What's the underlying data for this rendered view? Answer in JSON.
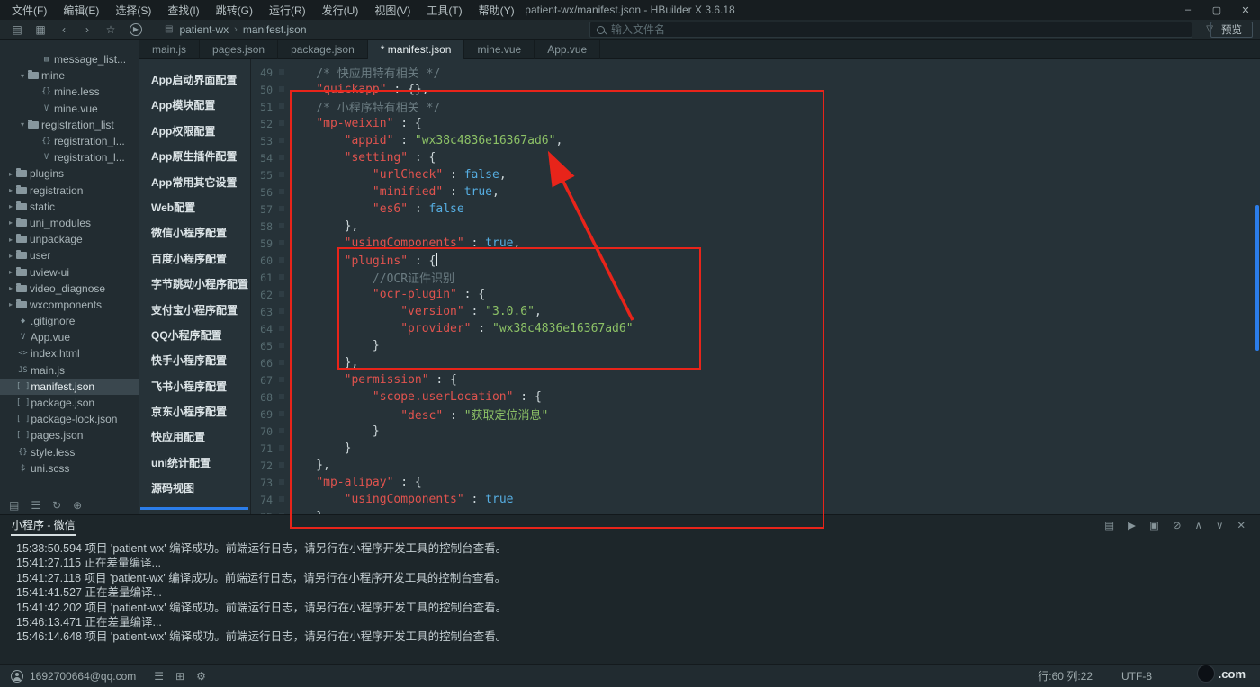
{
  "window": {
    "title": "patient-wx/manifest.json - HBuilder X 3.6.18",
    "menus": [
      "文件(F)",
      "编辑(E)",
      "选择(S)",
      "查找(I)",
      "跳转(G)",
      "运行(R)",
      "发行(U)",
      "视图(V)",
      "工具(T)",
      "帮助(Y)"
    ],
    "controls": [
      {
        "name": "minimize-button",
        "glyph": "–"
      },
      {
        "name": "maximize-button",
        "glyph": "▢"
      },
      {
        "name": "close-button",
        "glyph": "✕"
      }
    ]
  },
  "toolbar": {
    "icons": [
      {
        "name": "new-file-icon",
        "glyph": "▤"
      },
      {
        "name": "save-icon",
        "glyph": "▦"
      },
      {
        "name": "back-icon",
        "glyph": "‹"
      },
      {
        "name": "forward-icon",
        "glyph": "›"
      },
      {
        "name": "favorite-icon",
        "glyph": "☆"
      },
      {
        "name": "run-icon",
        "glyph": "▶"
      }
    ],
    "breadcrumb": [
      "patient-wx",
      "manifest.json"
    ],
    "search_placeholder": "输入文件名",
    "filter_icon": "▽",
    "preview_button": "预览"
  },
  "tabs": [
    {
      "label": "main.js",
      "active": false
    },
    {
      "label": "pages.json",
      "active": false
    },
    {
      "label": "package.json",
      "active": false
    },
    {
      "label": "* manifest.json",
      "active": true
    },
    {
      "label": "mine.vue",
      "active": false
    },
    {
      "label": "App.vue",
      "active": false
    }
  ],
  "sidebar": {
    "items": [
      {
        "label": "message_list...",
        "level": 2,
        "kind": "file",
        "icon": "▤"
      },
      {
        "label": "mine",
        "level": 1,
        "kind": "folder-open"
      },
      {
        "label": "mine.less",
        "level": 2,
        "kind": "file",
        "icon": "{}"
      },
      {
        "label": "mine.vue",
        "level": 2,
        "kind": "file",
        "icon": "V"
      },
      {
        "label": "registration_list",
        "level": 1,
        "kind": "folder-open"
      },
      {
        "label": "registration_l...",
        "level": 2,
        "kind": "file",
        "icon": "{}"
      },
      {
        "label": "registration_l...",
        "level": 2,
        "kind": "file",
        "icon": "V"
      },
      {
        "label": "plugins",
        "level": 0,
        "kind": "folder"
      },
      {
        "label": "registration",
        "level": 0,
        "kind": "folder"
      },
      {
        "label": "static",
        "level": 0,
        "kind": "folder"
      },
      {
        "label": "uni_modules",
        "level": 0,
        "kind": "folder"
      },
      {
        "label": "unpackage",
        "level": 0,
        "kind": "folder"
      },
      {
        "label": "user",
        "level": 0,
        "kind": "folder"
      },
      {
        "label": "uview-ui",
        "level": 0,
        "kind": "folder"
      },
      {
        "label": "video_diagnose",
        "level": 0,
        "kind": "folder"
      },
      {
        "label": "wxcomponents",
        "level": 0,
        "kind": "folder"
      },
      {
        "label": ".gitignore",
        "level": 0,
        "kind": "file",
        "icon": "◆"
      },
      {
        "label": "App.vue",
        "level": 0,
        "kind": "file",
        "icon": "V"
      },
      {
        "label": "index.html",
        "level": 0,
        "kind": "file",
        "icon": "<>"
      },
      {
        "label": "main.js",
        "level": 0,
        "kind": "file",
        "icon": "JS"
      },
      {
        "label": "manifest.json",
        "level": 0,
        "kind": "file",
        "icon": "[ ]",
        "selected": true
      },
      {
        "label": "package.json",
        "level": 0,
        "kind": "file",
        "icon": "[ ]"
      },
      {
        "label": "package-lock.json",
        "level": 0,
        "kind": "file",
        "icon": "[ ]"
      },
      {
        "label": "pages.json",
        "level": 0,
        "kind": "file",
        "icon": "[ ]"
      },
      {
        "label": "style.less",
        "level": 0,
        "kind": "file",
        "icon": "{}"
      },
      {
        "label": "uni.scss",
        "level": 0,
        "kind": "file",
        "icon": "$"
      }
    ],
    "bottom_icons": [
      {
        "name": "explorer-icon",
        "glyph": "▤"
      },
      {
        "name": "outline-icon",
        "glyph": "☰"
      },
      {
        "name": "refresh-icon",
        "glyph": "↻"
      },
      {
        "name": "add-icon",
        "glyph": "⊕"
      }
    ]
  },
  "config_panel": {
    "items": [
      "App启动界面配置",
      "App模块配置",
      "App权限配置",
      "App原生插件配置",
      "App常用其它设置",
      "Web配置",
      "微信小程序配置",
      "百度小程序配置",
      "字节跳动小程序配置",
      "支付宝小程序配置",
      "QQ小程序配置",
      "快手小程序配置",
      "飞书小程序配置",
      "京东小程序配置",
      "快应用配置",
      "uni统计配置",
      "源码视图"
    ],
    "active_item": "源码视图",
    "accent_color": "#2b7de9"
  },
  "editor": {
    "cursor": {
      "line": 60,
      "col": 22
    },
    "lines": [
      {
        "no": 49,
        "segs": [
          [
            "cm",
            "    /* 快应用特有相关 */"
          ]
        ]
      },
      {
        "no": 50,
        "segs": [
          [
            "pln",
            "    "
          ],
          [
            "key",
            "\"quickapp\""
          ],
          [
            "pun",
            " : {},"
          ]
        ]
      },
      {
        "no": 51,
        "segs": [
          [
            "cm",
            "    /* 小程序特有相关 */"
          ]
        ]
      },
      {
        "no": 52,
        "segs": [
          [
            "pln",
            "    "
          ],
          [
            "key",
            "\"mp-weixin\""
          ],
          [
            "pun",
            " : {"
          ]
        ]
      },
      {
        "no": 53,
        "segs": [
          [
            "pln",
            "        "
          ],
          [
            "key",
            "\"appid\""
          ],
          [
            "pun",
            " : "
          ],
          [
            "str",
            "\"wx38c4836e16367ad6\""
          ],
          [
            "pun",
            ","
          ]
        ]
      },
      {
        "no": 54,
        "segs": [
          [
            "pln",
            "        "
          ],
          [
            "key",
            "\"setting\""
          ],
          [
            "pun",
            " : {"
          ]
        ]
      },
      {
        "no": 55,
        "segs": [
          [
            "pln",
            "            "
          ],
          [
            "key",
            "\"urlCheck\""
          ],
          [
            "pun",
            " : "
          ],
          [
            "bool",
            "false"
          ],
          [
            "pun",
            ","
          ]
        ]
      },
      {
        "no": 56,
        "segs": [
          [
            "pln",
            "            "
          ],
          [
            "key",
            "\"minified\""
          ],
          [
            "pun",
            " : "
          ],
          [
            "bool",
            "true"
          ],
          [
            "pun",
            ","
          ]
        ]
      },
      {
        "no": 57,
        "segs": [
          [
            "pln",
            "            "
          ],
          [
            "key",
            "\"es6\""
          ],
          [
            "pun",
            " : "
          ],
          [
            "bool",
            "false"
          ]
        ]
      },
      {
        "no": 58,
        "segs": [
          [
            "pun",
            "        },"
          ]
        ]
      },
      {
        "no": 59,
        "segs": [
          [
            "pln",
            "        "
          ],
          [
            "key",
            "\"usingComponents\""
          ],
          [
            "pun",
            " : "
          ],
          [
            "bool",
            "true"
          ],
          [
            "pun",
            ","
          ]
        ]
      },
      {
        "no": 60,
        "segs": [
          [
            "pln",
            "        "
          ],
          [
            "key",
            "\"plugins\""
          ],
          [
            "pun",
            " : {"
          ]
        ]
      },
      {
        "no": 61,
        "segs": [
          [
            "cm",
            "            //OCR证件识别"
          ]
        ]
      },
      {
        "no": 62,
        "segs": [
          [
            "pln",
            "            "
          ],
          [
            "key",
            "\"ocr-plugin\""
          ],
          [
            "pun",
            " : {"
          ]
        ]
      },
      {
        "no": 63,
        "segs": [
          [
            "pln",
            "                "
          ],
          [
            "key",
            "\"version\""
          ],
          [
            "pun",
            " : "
          ],
          [
            "str",
            "\"3.0.6\""
          ],
          [
            "pun",
            ","
          ]
        ]
      },
      {
        "no": 64,
        "segs": [
          [
            "pln",
            "                "
          ],
          [
            "key",
            "\"provider\""
          ],
          [
            "pun",
            " : "
          ],
          [
            "str",
            "\"wx38c4836e16367ad6\""
          ]
        ]
      },
      {
        "no": 65,
        "segs": [
          [
            "pun",
            "            }"
          ]
        ]
      },
      {
        "no": 66,
        "segs": [
          [
            "pun",
            "        },"
          ]
        ]
      },
      {
        "no": 67,
        "segs": [
          [
            "pln",
            "        "
          ],
          [
            "key",
            "\"permission\""
          ],
          [
            "pun",
            " : {"
          ]
        ]
      },
      {
        "no": 68,
        "segs": [
          [
            "pln",
            "            "
          ],
          [
            "key",
            "\"scope.userLocation\""
          ],
          [
            "pun",
            " : {"
          ]
        ]
      },
      {
        "no": 69,
        "segs": [
          [
            "pln",
            "                "
          ],
          [
            "key",
            "\"desc\""
          ],
          [
            "pun",
            " : "
          ],
          [
            "str",
            "\"获取定位消息\""
          ]
        ]
      },
      {
        "no": 70,
        "segs": [
          [
            "pun",
            "            }"
          ]
        ]
      },
      {
        "no": 71,
        "segs": [
          [
            "pun",
            "        }"
          ]
        ]
      },
      {
        "no": 72,
        "segs": [
          [
            "pun",
            "    },"
          ]
        ]
      },
      {
        "no": 73,
        "segs": [
          [
            "pln",
            "    "
          ],
          [
            "key",
            "\"mp-alipay\""
          ],
          [
            "pun",
            " : {"
          ]
        ]
      },
      {
        "no": 74,
        "segs": [
          [
            "pln",
            "        "
          ],
          [
            "key",
            "\"usingComponents\""
          ],
          [
            "pun",
            " : "
          ],
          [
            "bool",
            "true"
          ]
        ]
      },
      {
        "no": 75,
        "segs": [
          [
            "pun",
            "    }"
          ]
        ]
      }
    ]
  },
  "annotations": {
    "color": "#e8241a"
  },
  "console": {
    "tab": "小程序 - 微信",
    "icons": [
      {
        "name": "export-log-icon",
        "glyph": "▤"
      },
      {
        "name": "run-log-icon",
        "glyph": "▶"
      },
      {
        "name": "panel-icon",
        "glyph": "▣"
      },
      {
        "name": "clear-log-icon",
        "glyph": "⊘"
      },
      {
        "name": "scroll-up-icon",
        "glyph": "∧"
      },
      {
        "name": "scroll-down-icon",
        "glyph": "∨"
      },
      {
        "name": "close-console-icon",
        "glyph": "✕"
      }
    ],
    "lines": [
      "15:38:50.594 项目 'patient-wx' 编译成功。前端运行日志，请另行在小程序开发工具的控制台查看。",
      "15:41:27.115 正在差量编译...",
      "15:41:27.118 项目 'patient-wx' 编译成功。前端运行日志，请另行在小程序开发工具的控制台查看。",
      "15:41:41.527 正在差量编译...",
      "15:41:42.202 项目 'patient-wx' 编译成功。前端运行日志，请另行在小程序开发工具的控制台查看。",
      "15:46:13.471 正在差量编译...",
      "15:46:14.648 项目 'patient-wx' 编译成功。前端运行日志，请另行在小程序开发工具的控制台查看。"
    ]
  },
  "statusbar": {
    "account": "1692700664@qq.com",
    "icons": [
      {
        "name": "list-icon",
        "glyph": "☰"
      },
      {
        "name": "grid-icon",
        "glyph": "⊞"
      },
      {
        "name": "settings-icon",
        "glyph": "⚙"
      }
    ],
    "position": "行:60 列:22",
    "encoding": "UTF-8",
    "watermark": ".com"
  }
}
